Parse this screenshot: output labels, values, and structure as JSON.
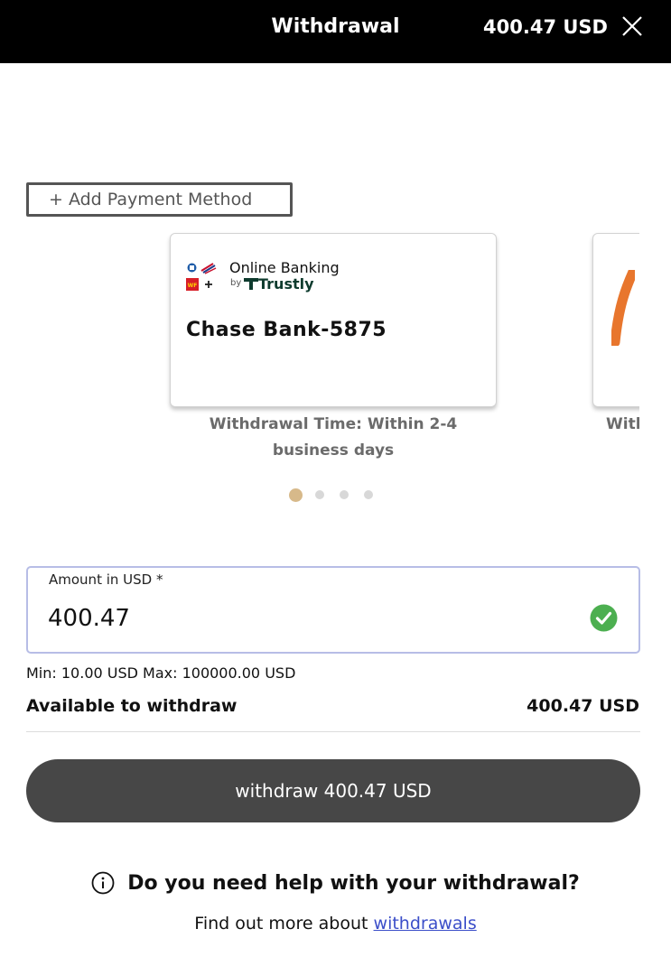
{
  "header": {
    "title": "Withdrawal",
    "balance": "400.47 USD",
    "close_icon": "close-icon"
  },
  "add_payment": {
    "label": "+ Add Payment Method"
  },
  "payment_cards": [
    {
      "provider": "Online Banking",
      "by": "by",
      "partner": "Trustly",
      "account": "Chase Bank-5875",
      "caption": "Withdrawal Time: Within 2-4 business days",
      "icons": [
        "chase-logo-icon",
        "bank-of-america-logo-icon",
        "wells-fargo-logo-icon",
        "plus-icon",
        "trustly-logo-icon"
      ]
    },
    {
      "caption": "Witl"
    }
  ],
  "carousel": {
    "total": 4,
    "active_index": 0
  },
  "amount": {
    "label": "Amount in USD *",
    "value": "400.47",
    "valid_icon": "check-circle-icon"
  },
  "limits": {
    "text": "Min: 10.00 USD Max: 100000.00 USD"
  },
  "available": {
    "label": "Available to withdraw",
    "value": "400.47 USD"
  },
  "withdraw_button": {
    "label": "withdraw 400.47 USD"
  },
  "help": {
    "icon": "info-icon",
    "title": "Do you need help with your withdrawal?",
    "prefix": "Find out more about",
    "link": "withdrawals"
  },
  "colors": {
    "header_bg": "#000000",
    "button_bg": "#474747",
    "active_dot": "#d7b98a",
    "inactive_dot": "#d8d8d8",
    "input_border": "#b7bde6",
    "valid_green": "#4caf50",
    "link": "#3b4ec9"
  }
}
